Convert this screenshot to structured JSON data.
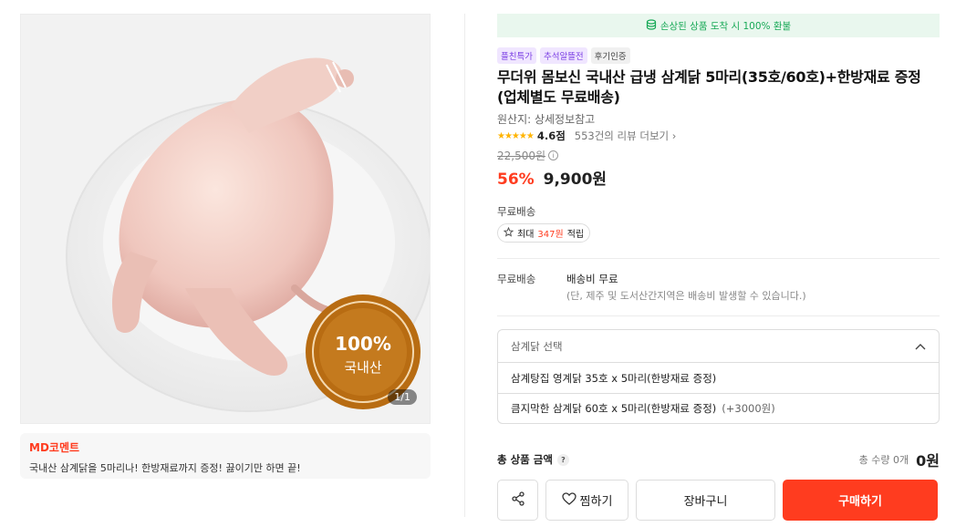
{
  "product_image": {
    "counter": "1/1",
    "badge_percent": "100%",
    "badge_text": "국내산"
  },
  "md_comment": {
    "title": "MD코멘트",
    "text": "국내산 삼계닭을 5마리나! 한방재료까지 증정! 끓이기만 하면 끝!"
  },
  "refund_banner": "손상된 상품 도착 시 100% 환불",
  "tags": [
    {
      "label": "플친특가",
      "color": "purple"
    },
    {
      "label": "추석알뜰전",
      "color": "purple"
    },
    {
      "label": "후기인증",
      "color": "gray"
    }
  ],
  "title": "무더위 몸보신 국내산 급냉 삼계닭 5마리(35호/60호)+한방재료 증정 (업체별도 무료배송)",
  "origin": "원산지: 상세정보참고",
  "rating": {
    "stars": 4.6,
    "value": "4.6점",
    "reviews": "553건의 리뷰 더보기"
  },
  "price": {
    "original": "22,500원",
    "discount": "56%",
    "sale": "9,900원"
  },
  "shipping_short": "무료배송",
  "points": {
    "prefix": "최대",
    "amount": "347원",
    "suffix": "적립"
  },
  "shipping": {
    "label": "무료배송",
    "main": "배송비 무료",
    "sub": "(단, 제주 및 도서산간지역은 배송비 발생할 수 있습니다.)"
  },
  "options": {
    "header": "삼계닭 선택",
    "items": [
      {
        "label": "삼계탕집 영계닭 35호 x 5마리(한방재료 증정)",
        "extra": ""
      },
      {
        "label": "큼지막한 삼계닭 60호 x 5마리(한방재료 증정)",
        "extra": "(+3000원)"
      }
    ]
  },
  "total": {
    "label": "총 상품 금액",
    "qty": "총 수량 0개",
    "price": "0원"
  },
  "buttons": {
    "wish": "찜하기",
    "cart": "장바구니",
    "buy": "구매하기"
  },
  "colors": {
    "accent": "#ff3c1f",
    "refund_green": "#18a957",
    "star": "#ffb400",
    "badge_gold": "#b86c12"
  },
  "icons": [
    "coin-icon",
    "star-icon",
    "chevron-right-icon",
    "info-icon",
    "gift-icon",
    "chevron-up-icon",
    "help-icon",
    "share-icon",
    "heart-icon"
  ]
}
